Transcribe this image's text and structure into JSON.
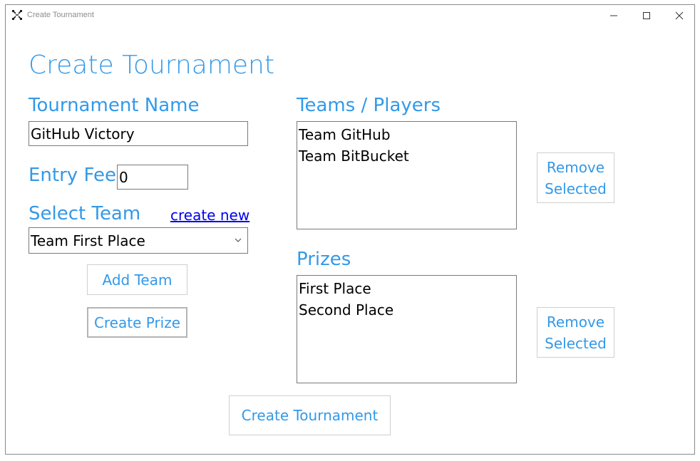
{
  "window": {
    "title": "Create Tournament",
    "icons": {
      "app": "app-icon",
      "minimize": "minimize-icon",
      "maximize": "maximize-icon",
      "close": "close-icon"
    }
  },
  "header": "Create Tournament",
  "tournament_name": {
    "label": "Tournament Name",
    "value": "GitHub Victory"
  },
  "entry_fee": {
    "label": "Entry Fee",
    "value": "0"
  },
  "select_team": {
    "label": "Select Team",
    "create_new_link": "create new",
    "selected": "Team First Place"
  },
  "buttons": {
    "add_team": "Add Team",
    "create_prize": "Create Prize",
    "create_tournament": "Create Tournament"
  },
  "teams_players": {
    "label": "Teams / Players",
    "items": [
      "Team GitHub",
      "Team BitBucket"
    ],
    "remove_line1": "Remove",
    "remove_line2": "Selected"
  },
  "prizes": {
    "label": "Prizes",
    "items": [
      "First Place",
      "Second Place"
    ],
    "remove_line1": "Remove",
    "remove_line2": "Selected"
  },
  "colors": {
    "accent": "#3399e8",
    "link": "#0000ee",
    "border": "#7a7a7a"
  }
}
